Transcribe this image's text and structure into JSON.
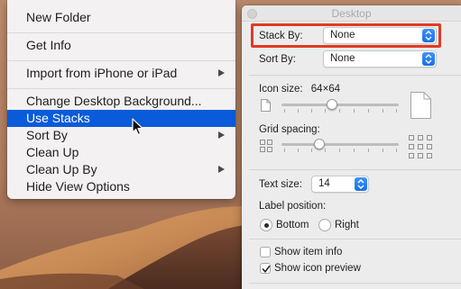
{
  "context_menu": {
    "items": [
      {
        "label": "New Folder"
      },
      {
        "label": "Get Info"
      },
      {
        "label": "Import from iPhone or iPad"
      },
      {
        "label": "Change Desktop Background..."
      },
      {
        "label": "Use Stacks"
      },
      {
        "label": "Sort By"
      },
      {
        "label": "Clean Up"
      },
      {
        "label": "Clean Up By"
      },
      {
        "label": "Hide View Options"
      }
    ],
    "selected_item": "Use Stacks"
  },
  "view_options": {
    "title": "Desktop",
    "stack_by": {
      "label": "Stack By:",
      "value": "None"
    },
    "sort_by": {
      "label": "Sort By:",
      "value": "None"
    },
    "icon_size": {
      "label": "Icon size:",
      "value": "64×64",
      "level": 0.35
    },
    "grid_spacing": {
      "label": "Grid spacing:",
      "level": 0.3
    },
    "text_size": {
      "label": "Text size:",
      "value": "14"
    },
    "label_position": {
      "label": "Label position:",
      "options": [
        "Bottom",
        "Right"
      ],
      "selected": "Bottom"
    },
    "show_item_info": {
      "label": "Show item info",
      "checked": false
    },
    "show_icon_preview": {
      "label": "Show icon preview",
      "checked": true
    }
  },
  "colors": {
    "menu_selection": "#0a5bd9",
    "highlight_outline": "#e23a24",
    "popup_stepper": "#1a6fe8"
  }
}
